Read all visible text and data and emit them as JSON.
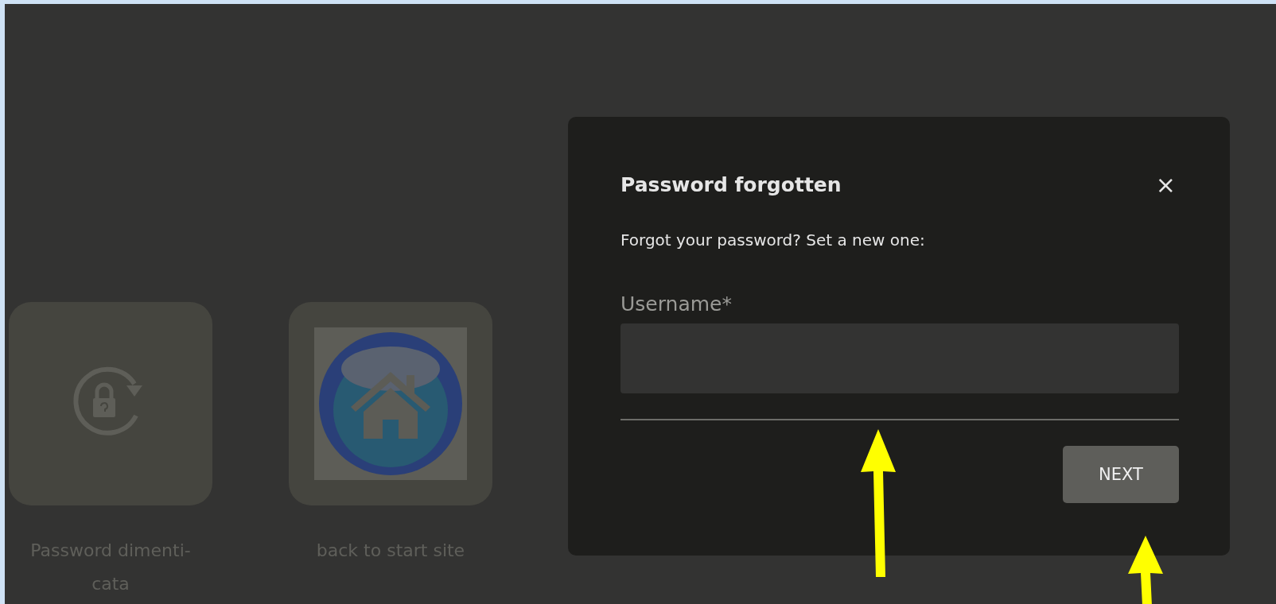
{
  "tiles": [
    {
      "kind": "lock",
      "label_lines": [
        "Password dimenti-",
        "cata"
      ]
    },
    {
      "kind": "home",
      "label_lines": [
        "back to start site"
      ]
    }
  ],
  "dialog": {
    "title": "Password forgotten",
    "close": "×",
    "description": "Forgot your password? Set a new one:",
    "field": {
      "label": "Username*"
    },
    "button": "NEXT"
  }
}
